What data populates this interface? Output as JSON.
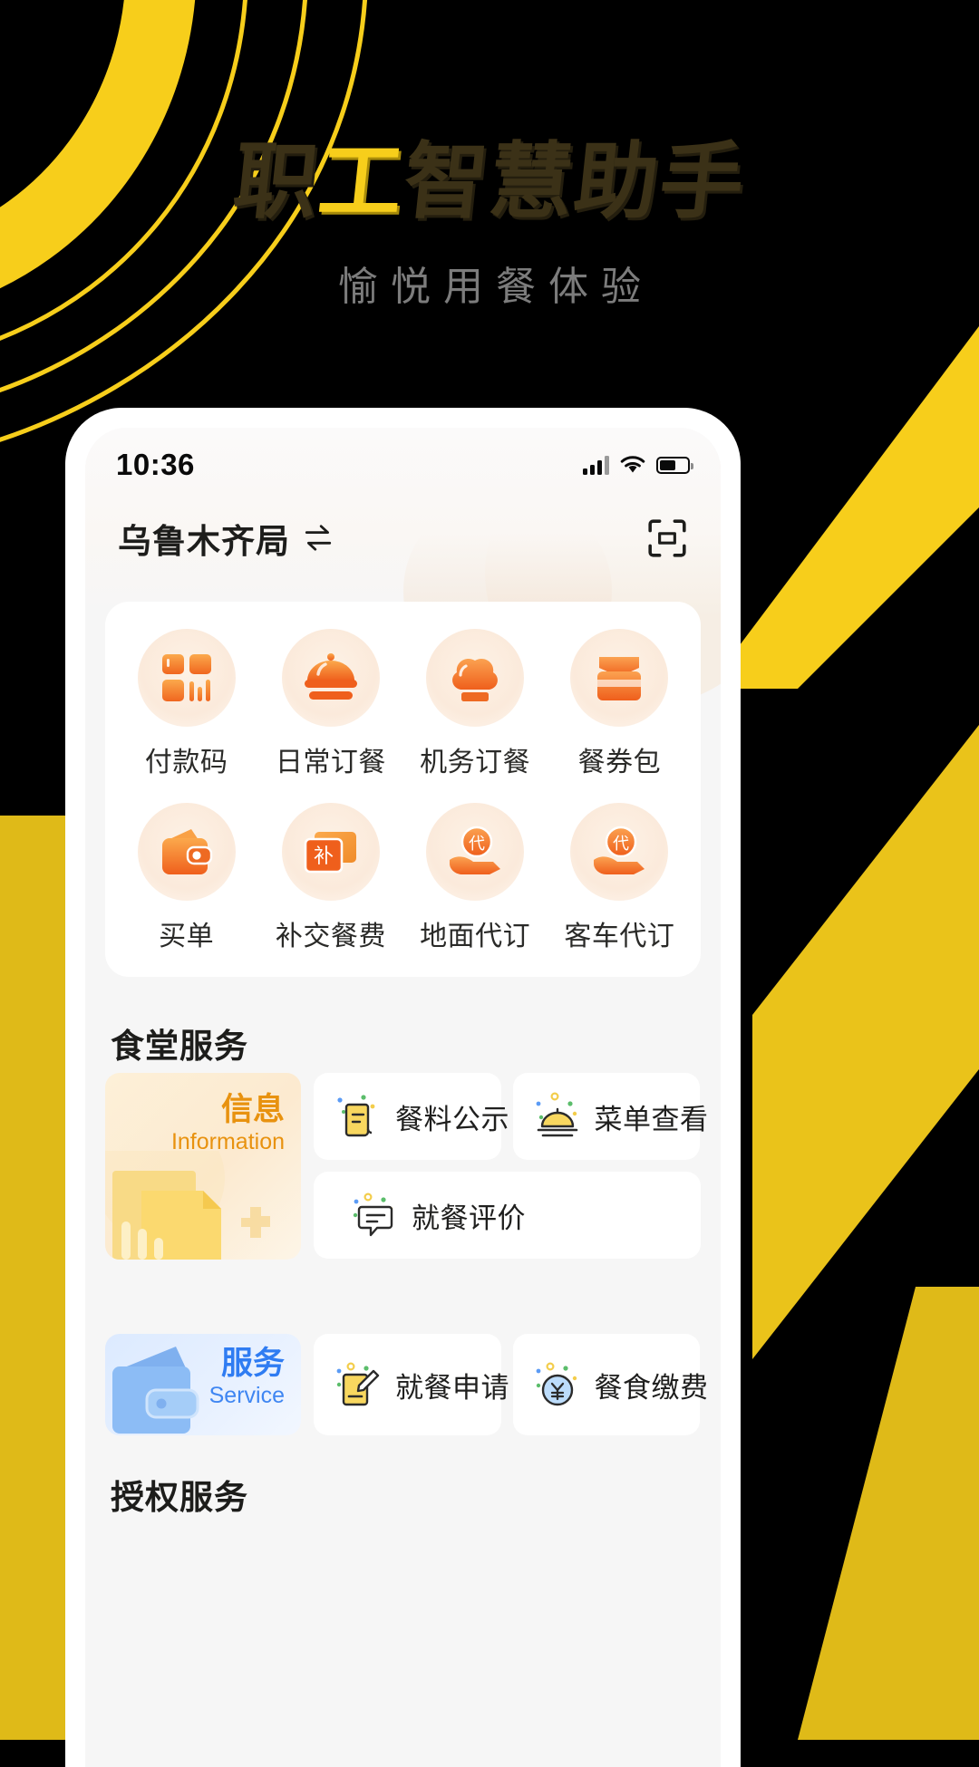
{
  "promo": {
    "title_parts": [
      {
        "text": "职",
        "highlight": false
      },
      {
        "text": "工",
        "highlight": true
      },
      {
        "text": "智慧助手",
        "highlight": false
      }
    ],
    "title_full": "职工智慧助手",
    "subtitle": "愉悦用餐体验",
    "accent_yellow": "#F7CE1B",
    "title_dark": "#3b3117",
    "subtitle_color": "#7c7c7c",
    "background": "#000000"
  },
  "phone": {
    "status_bar": {
      "time": "10:36",
      "signal_icon": "signal-bars-icon",
      "wifi_icon": "wifi-icon",
      "battery_icon": "battery-icon"
    },
    "header": {
      "location": "乌鲁木齐局",
      "switch_icon": "swap-arrows-icon",
      "scan_icon": "scan-qr-icon"
    },
    "grid": {
      "rows": [
        [
          {
            "label": "付款码",
            "icon": "qr-payment-code-icon"
          },
          {
            "label": "日常订餐",
            "icon": "cloche-dish-icon"
          },
          {
            "label": "机务订餐",
            "icon": "chef-hat-icon"
          },
          {
            "label": "餐券包",
            "icon": "meal-voucher-wallet-icon"
          }
        ],
        [
          {
            "label": "买单",
            "icon": "wallet-icon"
          },
          {
            "label": "补交餐费",
            "icon": "supplement-card-icon"
          },
          {
            "label": "地面代订",
            "icon": "hand-proxy-order-icon"
          },
          {
            "label": "客车代订",
            "icon": "hand-proxy-order-icon"
          }
        ]
      ]
    },
    "sections": [
      {
        "title": "食堂服务",
        "banner": {
          "cn": "信息",
          "en": "Information",
          "theme": "info",
          "art_icon": "documents-art-icon"
        },
        "tiles": [
          {
            "label": "餐料公示",
            "icon": "ingredient-list-icon",
            "size": "half"
          },
          {
            "label": "菜单查看",
            "icon": "menu-cloche-icon",
            "size": "half"
          },
          {
            "label": "就餐评价",
            "icon": "comment-review-icon",
            "size": "full"
          }
        ]
      },
      {
        "title": "",
        "banner": {
          "cn": "服务",
          "en": "Service",
          "theme": "service",
          "art_icon": "blue-wallet-art-icon"
        },
        "tiles": [
          {
            "label": "就餐申请",
            "icon": "apply-form-icon",
            "size": "half"
          },
          {
            "label": "餐食缴费",
            "icon": "yuan-payment-icon",
            "size": "half"
          }
        ]
      }
    ],
    "next_section_title": "授权服务"
  }
}
